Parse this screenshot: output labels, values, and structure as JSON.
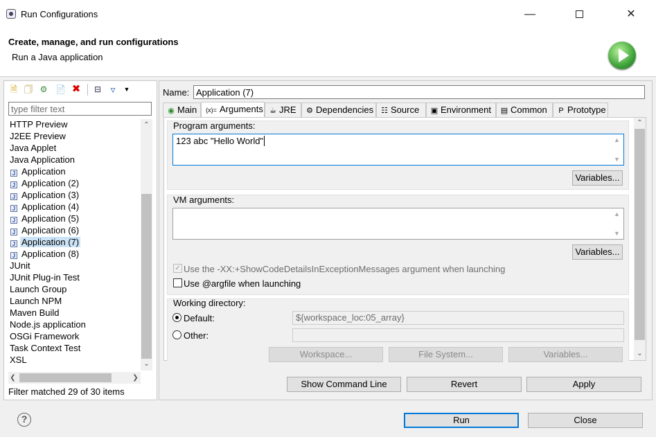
{
  "window": {
    "title": "Run Configurations",
    "icons": {
      "app": "eclipse-icon",
      "minimize": "minimize-icon",
      "maximize": "maximize-icon",
      "close": "close-icon"
    }
  },
  "header": {
    "title": "Create, manage, and run configurations",
    "subtitle": "Run a Java application",
    "logo_icon": "run-icon"
  },
  "left": {
    "toolbar_icons": [
      "new-configuration-icon",
      "new-prototype-icon",
      "export-icon",
      "duplicate-icon",
      "delete-icon",
      "collapse-all-icon",
      "filter-icon",
      "dropdown-icon"
    ],
    "filter_placeholder": "type filter text",
    "tree": [
      {
        "label": "HTTP Preview",
        "icon": ""
      },
      {
        "label": "J2EE Preview",
        "icon": ""
      },
      {
        "label": "Java Applet",
        "icon": ""
      },
      {
        "label": "Java Application",
        "icon": ""
      },
      {
        "label": "Application",
        "icon": "java-app-icon"
      },
      {
        "label": "Application (2)",
        "icon": "java-app-icon"
      },
      {
        "label": "Application (3)",
        "icon": "java-app-icon"
      },
      {
        "label": "Application (4)",
        "icon": "java-app-icon"
      },
      {
        "label": "Application (5)",
        "icon": "java-app-icon"
      },
      {
        "label": "Application (6)",
        "icon": "java-app-icon"
      },
      {
        "label": "Application (7)",
        "icon": "java-app-icon",
        "selected": true
      },
      {
        "label": "Application (8)",
        "icon": "java-app-icon"
      },
      {
        "label": "JUnit",
        "icon": ""
      },
      {
        "label": "JUnit Plug-in Test",
        "icon": ""
      },
      {
        "label": "Launch Group",
        "icon": ""
      },
      {
        "label": "Launch NPM",
        "icon": ""
      },
      {
        "label": "Maven Build",
        "icon": ""
      },
      {
        "label": "Node.js application",
        "icon": ""
      },
      {
        "label": "OSGi Framework",
        "icon": ""
      },
      {
        "label": "Task Context Test",
        "icon": ""
      },
      {
        "label": "XSL",
        "icon": ""
      }
    ],
    "status": "Filter matched 29 of 30 items"
  },
  "right": {
    "name_label": "Name:",
    "name_value": "Application (7)",
    "tabs": [
      {
        "label": "Main",
        "icon": "main-tab-icon"
      },
      {
        "label": "Arguments",
        "icon": "arguments-tab-icon",
        "active": true
      },
      {
        "label": "JRE",
        "icon": "jre-tab-icon"
      },
      {
        "label": "Dependencies",
        "icon": "dependencies-tab-icon"
      },
      {
        "label": "Source",
        "icon": "source-tab-icon"
      },
      {
        "label": "Environment",
        "icon": "environment-tab-icon"
      },
      {
        "label": "Common",
        "icon": "common-tab-icon"
      },
      {
        "label": "Prototype",
        "icon": "prototype-tab-icon"
      }
    ],
    "program_args": {
      "label": "Program arguments:",
      "value": "123 abc \"Hello World\"",
      "variables": "Variables..."
    },
    "vm_args": {
      "label": "VM arguments:",
      "value": "",
      "variables": "Variables..."
    },
    "show_code_details": {
      "label": "Use the -XX:+ShowCodeDetailsInExceptionMessages argument when launching",
      "checked": true,
      "disabled": true
    },
    "argfile": {
      "label": "Use @argfile when launching",
      "checked": false
    },
    "working_dir": {
      "label": "Working directory:",
      "default_label": "Default:",
      "default_value": "${workspace_loc:05_array}",
      "other_label": "Other:",
      "other_value": "",
      "buttons": [
        "Workspace...",
        "File System...",
        "Variables..."
      ]
    },
    "actions": {
      "show_command_line": "Show Command Line",
      "revert": "Revert",
      "apply": "Apply"
    }
  },
  "footer": {
    "help_icon": "help-icon",
    "run": "Run",
    "close": "Close"
  }
}
